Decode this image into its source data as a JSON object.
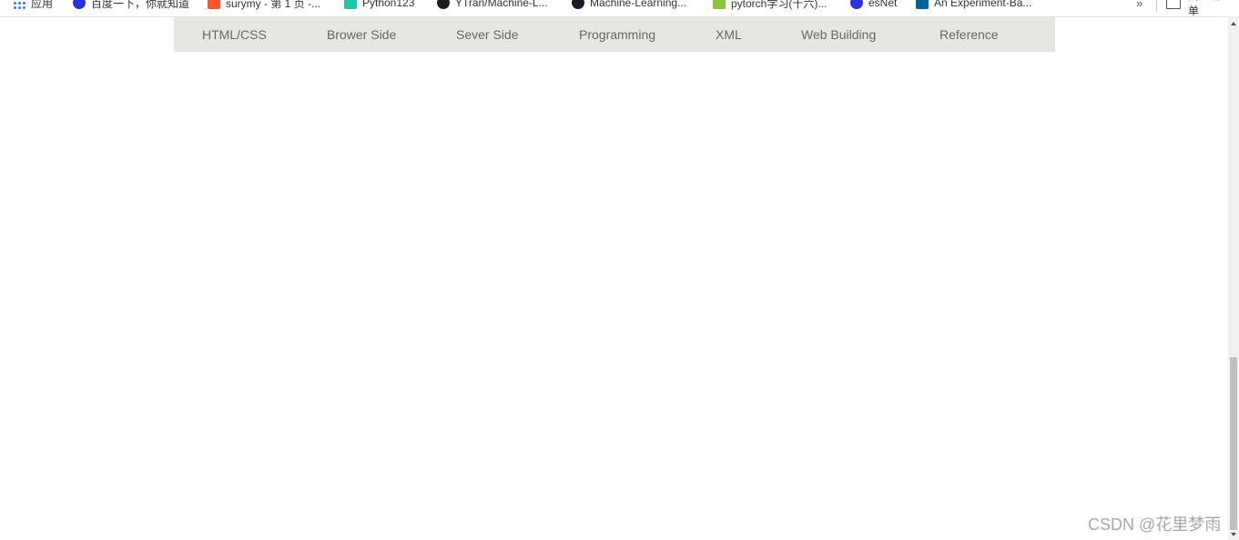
{
  "bookmarks": {
    "items": [
      {
        "label": "应用",
        "icon": "apps-grid-icon"
      },
      {
        "label": "百度一下，你就知道",
        "icon": "baidu-icon"
      },
      {
        "label": "surymy - 第 1 页 -...",
        "icon": "csdn-icon"
      },
      {
        "label": "Python123",
        "icon": "python123-icon"
      },
      {
        "label": "YTran/Machine-L...",
        "icon": "github-icon"
      },
      {
        "label": "Machine-Learning...",
        "icon": "github-icon"
      },
      {
        "label": "pytorch学习(十六)...",
        "icon": "pytorch-icon"
      },
      {
        "label": "esNet",
        "icon": "baidu-icon"
      },
      {
        "label": "An Experiment-Ba...",
        "icon": "ieee-icon"
      }
    ],
    "more": "»",
    "reading_list": "阅读清单"
  },
  "topnav": {
    "links": [
      "HTML/CSS",
      "Brower Side",
      "Sever Side",
      "Programming",
      "XML",
      "Web Building",
      "Reference"
    ],
    "background": "#e7e6e2",
    "text_color": "#666666"
  },
  "watermark": "CSDN @花里梦雨"
}
